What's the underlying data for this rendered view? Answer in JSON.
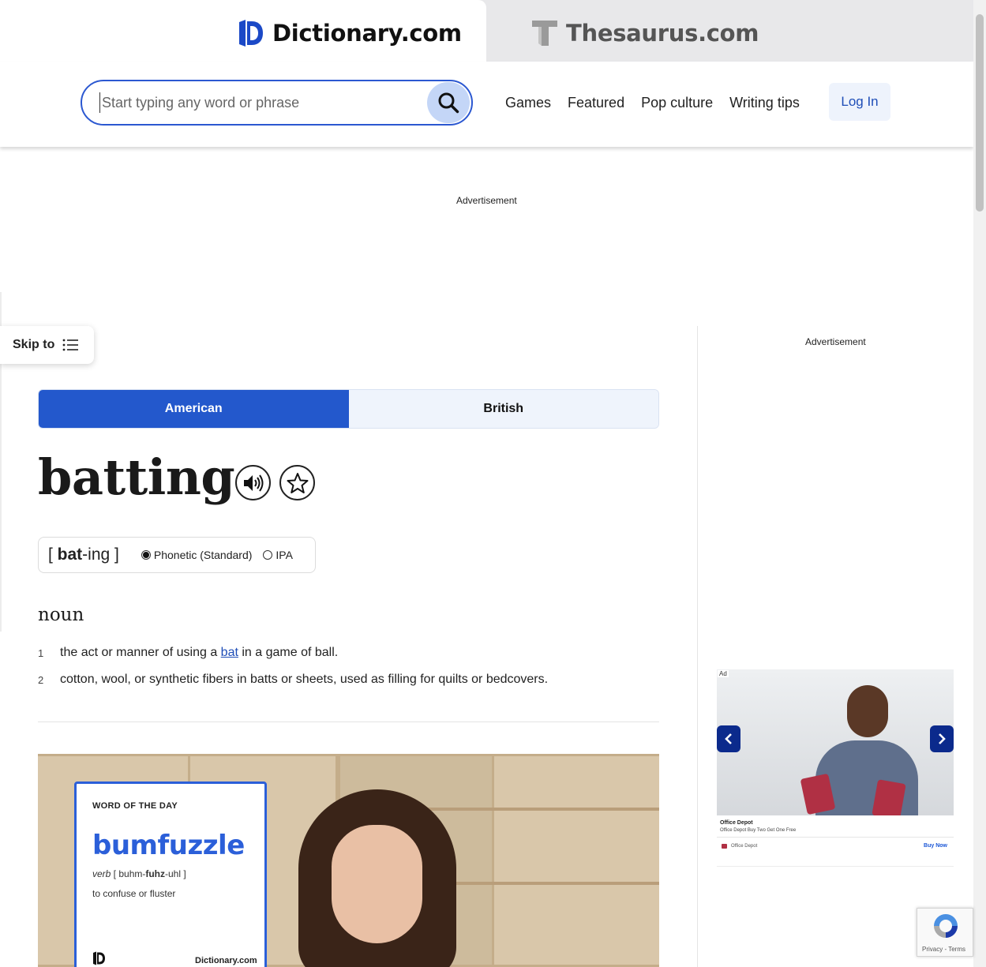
{
  "brand": {
    "dictionary": "Dictionary.com",
    "thesaurus": "Thesaurus.com"
  },
  "search": {
    "placeholder": "Start typing any word or phrase",
    "icon": "search-icon"
  },
  "nav": {
    "items": [
      "Games",
      "Featured",
      "Pop culture",
      "Writing tips"
    ],
    "login": "Log In"
  },
  "ads": {
    "top_label": "Advertisement",
    "side_label": "Advertisement"
  },
  "skip_to": {
    "label": "Skip to",
    "icon": "list-icon"
  },
  "dialect": {
    "american": "American",
    "british": "British",
    "selected": "American"
  },
  "entry": {
    "headword": "batting",
    "audio_icon": "speaker-icon",
    "favorite_icon": "star-icon",
    "pronunciation": {
      "open": "[ ",
      "stressed": "bat",
      "rest": "-ing",
      "close": " ]",
      "options": [
        "Phonetic (Standard)",
        "IPA"
      ],
      "selected": "Phonetic (Standard)"
    },
    "part_of_speech": "noun",
    "definitions": [
      {
        "num": "1",
        "before": "the act or manner of using a ",
        "link": "bat",
        "after": " in a game of ball."
      },
      {
        "num": "2",
        "text": "cotton, wool, or synthetic fibers in batts or sheets, used as filling for quilts or bedcovers."
      }
    ]
  },
  "video": {
    "kicker": "WORD OF THE DAY",
    "word": "bumfuzzle",
    "pos": "verb",
    "pron_open": " [ buhm-",
    "pron_stressed": "fuhz",
    "pron_close": "-uhl ]",
    "definition": "to confuse or fluster",
    "brand": "Dictionary.com"
  },
  "side_ad": {
    "tag": "Ad",
    "title": "Office Depot",
    "subtitle": "Office Depot Buy Two Get One Free",
    "brand": "Office Depot",
    "cta": "Buy Now"
  },
  "recaptcha": {
    "privacy": "Privacy",
    "sep": " - ",
    "terms": "Terms"
  },
  "colors": {
    "accent": "#2358cc",
    "search_border": "#2b58d1",
    "link": "#1e4db7"
  }
}
